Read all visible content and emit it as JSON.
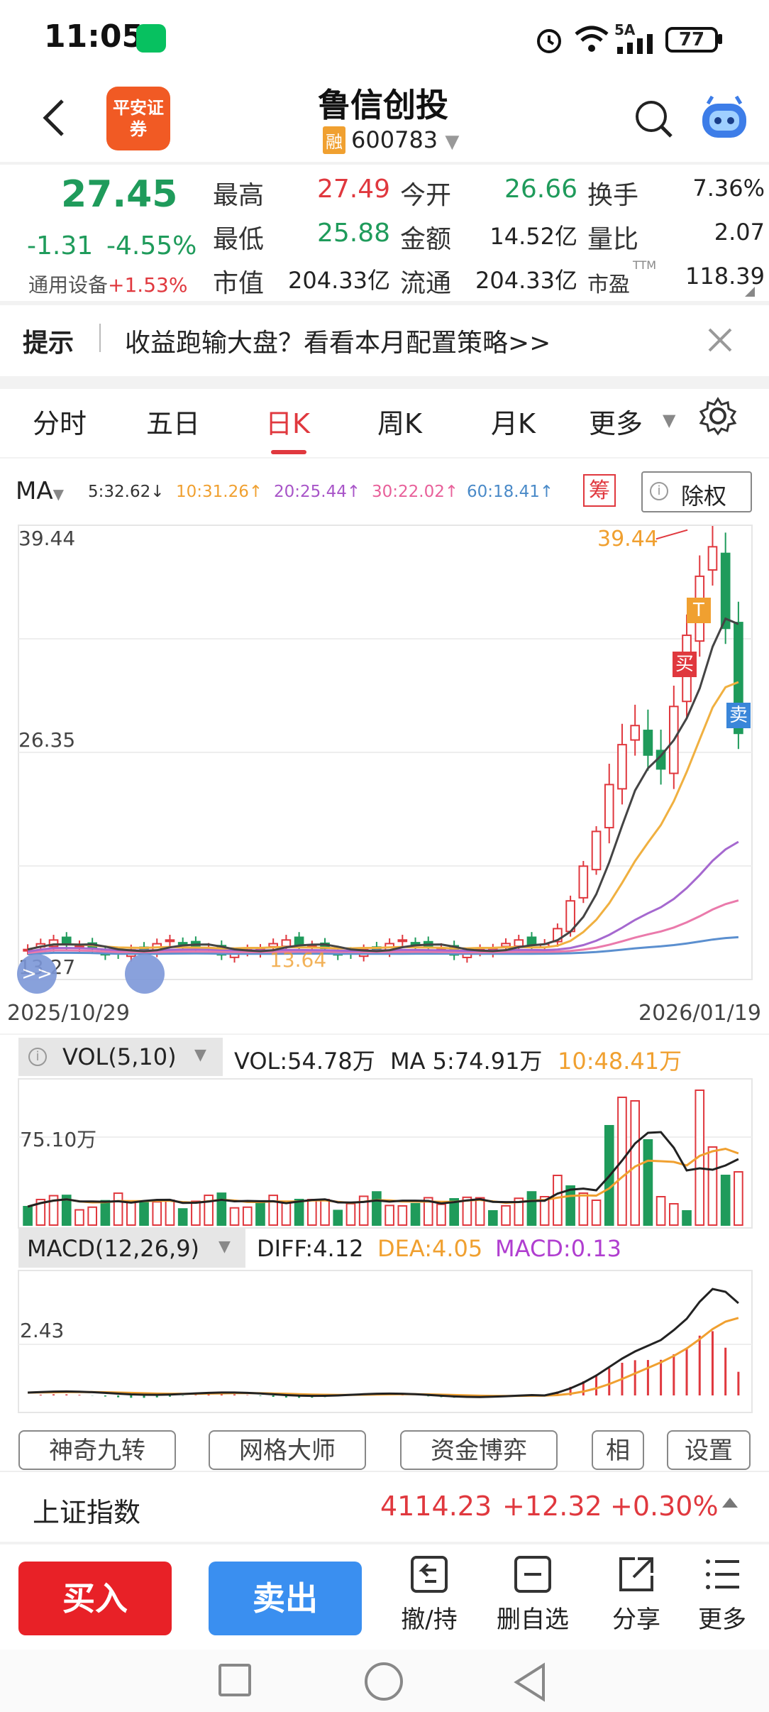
{
  "status": {
    "time": "11:05",
    "network": "5A",
    "battery": "77"
  },
  "header": {
    "logo_text": "平安证券",
    "title": "鲁信创投",
    "margin_tag": "融",
    "code": "600783"
  },
  "quote": {
    "price": "27.45",
    "change": "-1.31",
    "change_pct": "-4.55%",
    "sector_label": "通用设备",
    "sector_change": "+1.53%",
    "cells": [
      {
        "label": "最高",
        "value": "27.49",
        "color": "up"
      },
      {
        "label": "今开",
        "value": "26.66",
        "color": "down"
      },
      {
        "label": "换手",
        "value": "7.36%",
        "color": ""
      },
      {
        "label": "最低",
        "value": "25.88",
        "color": "down"
      },
      {
        "label": "金额",
        "value": "14.52亿",
        "color": ""
      },
      {
        "label": "量比",
        "value": "2.07",
        "color": ""
      },
      {
        "label": "市值",
        "value": "204.33亿",
        "color": ""
      },
      {
        "label": "流通",
        "value": "204.33亿",
        "color": ""
      },
      {
        "label": "市盈",
        "value": "118.39",
        "color": "",
        "sup": "TTM"
      }
    ]
  },
  "notice": {
    "label": "提示",
    "text": "收益跑输大盘？看看本月配置策略>>"
  },
  "tabs": {
    "items": [
      "分时",
      "五日",
      "日K",
      "周K",
      "月K",
      "更多"
    ],
    "active": "日K"
  },
  "ma": {
    "label": "MA",
    "items": [
      {
        "text": "5:32.62↓",
        "color": "#333333"
      },
      {
        "text": "10:31.26↑",
        "color": "#f0a030"
      },
      {
        "text": "20:25.44↑",
        "color": "#a855c8"
      },
      {
        "text": "30:22.02↑",
        "color": "#e8609a"
      },
      {
        "text": "60:18.41↑",
        "color": "#4a8ac8"
      }
    ],
    "chip_label": "筹",
    "fuquan_label": "除权"
  },
  "kchart": {
    "y_high_label": "39.44",
    "y_mid_label": "26.35",
    "y_low_label": "13.27",
    "max_marker": "39.44",
    "min_marker": "13.64",
    "date_start": "2025/10/29",
    "date_end": "2026/01/19",
    "buy_tag": "买",
    "sell_tag": "卖",
    "t_tag": "T"
  },
  "vol": {
    "title": "VOL(5,10)",
    "vol": "VOL:54.78万",
    "ma5": "MA 5:74.91万",
    "ma10": "10:48.41万",
    "y_label": "75.10万"
  },
  "macd": {
    "title": "MACD(12,26,9)",
    "diff": "DIFF:4.12",
    "dea": "DEA:4.05",
    "macd": "MACD:0.13",
    "y_label": "2.43"
  },
  "tools": {
    "items": [
      "神奇九转",
      "网格大师",
      "资金博弈",
      "相",
      "设置"
    ]
  },
  "index": {
    "name": "上证指数",
    "value": "4114.23",
    "change": "+12.32",
    "pct": "+0.30%"
  },
  "actions": {
    "buy": "买入",
    "sell": "卖出",
    "withdraw": "撤/持",
    "delete": "删自选",
    "share": "分享",
    "more": "更多"
  }
}
